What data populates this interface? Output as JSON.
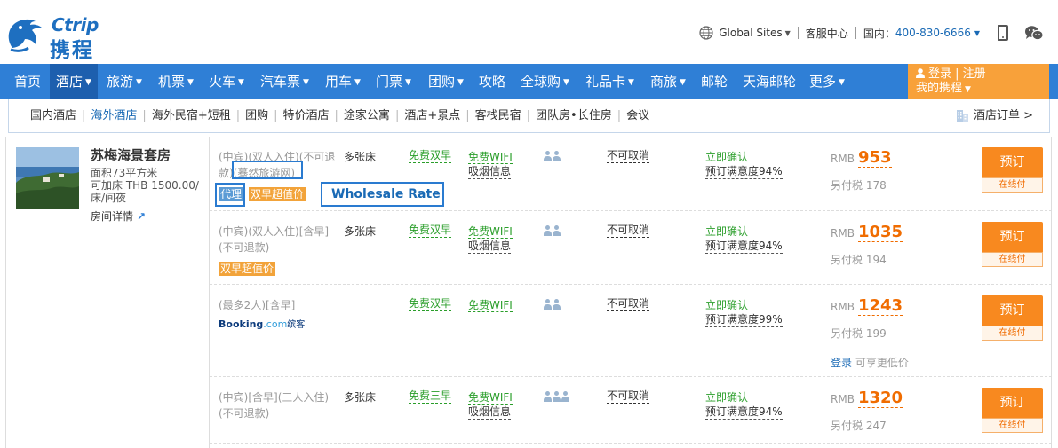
{
  "logo": {
    "en": "Ctrip",
    "cn": "携程"
  },
  "top_util": {
    "global_sites": "Global Sites",
    "service_center": "客服中心",
    "domestic_label": "国内：",
    "phone": "400-830-6666"
  },
  "nav": {
    "items": [
      {
        "label": "首页",
        "dropdown": false
      },
      {
        "label": "酒店",
        "dropdown": true,
        "active": true
      },
      {
        "label": "旅游",
        "dropdown": true
      },
      {
        "label": "机票",
        "dropdown": true
      },
      {
        "label": "火车",
        "dropdown": true
      },
      {
        "label": "汽车票",
        "dropdown": true
      },
      {
        "label": "用车",
        "dropdown": true
      },
      {
        "label": "门票",
        "dropdown": true
      },
      {
        "label": "团购",
        "dropdown": true
      },
      {
        "label": "攻略",
        "dropdown": false
      },
      {
        "label": "全球购",
        "dropdown": true
      },
      {
        "label": "礼品卡",
        "dropdown": true
      },
      {
        "label": "商旅",
        "dropdown": true
      },
      {
        "label": "邮轮",
        "dropdown": false
      },
      {
        "label": "天海邮轮",
        "dropdown": false
      },
      {
        "label": "更多",
        "dropdown": true
      }
    ],
    "account": {
      "login": "登录",
      "register": "注册",
      "my_ctrip": "我的携程"
    }
  },
  "subnav": {
    "items": [
      "国内酒店",
      "海外酒店",
      "海外民宿+短租",
      "团购",
      "特价酒店",
      "途家公寓",
      "酒店+景点",
      "客栈民宿",
      "团队房•长住房",
      "会议"
    ],
    "active_index": 1,
    "hotel_order": "酒店订单 >"
  },
  "room": {
    "name": "苏梅海景套房",
    "info_lines": [
      "面积73平方米",
      "可加床 THB 1500.00/",
      "床/间夜"
    ],
    "detail_link": "房间详情"
  },
  "rates": [
    {
      "name_lines": [
        "(中宾)(双人入住)(不可退",
        "款)(蓦然旅游网)"
      ],
      "bed": "多张床",
      "breakfast": "免费双早",
      "wifi": "免费WIFI",
      "smoke": "吸烟信息",
      "people": 2,
      "cancel": "不可取消",
      "confirm": "立即确认",
      "satisfaction": "预订满意度94%",
      "currency": "RMB",
      "price": "953",
      "tax": "另付税 178",
      "book": "预订",
      "pay": "在线付",
      "tag_agent": "代理",
      "tag_deal": "双早超值价",
      "annotation": "Wholesale Rate"
    },
    {
      "name_lines": [
        "(中宾)(双人入住)[含早]",
        "(不可退款)"
      ],
      "bed": "多张床",
      "breakfast": "免费双早",
      "wifi": "免费WIFI",
      "smoke": "吸烟信息",
      "people": 2,
      "cancel": "不可取消",
      "confirm": "立即确认",
      "satisfaction": "预订满意度94%",
      "currency": "RMB",
      "price": "1035",
      "tax": "另付税 194",
      "book": "预订",
      "pay": "在线付",
      "tag_deal": "双早超值价"
    },
    {
      "name_lines": [
        "(最多2人)[含早]"
      ],
      "bed": "",
      "breakfast": "免费双早",
      "wifi": "免费WIFI",
      "smoke": "",
      "people": 2,
      "cancel": "不可取消",
      "confirm": "立即确认",
      "satisfaction": "预订满意度99%",
      "currency": "RMB",
      "price": "1243",
      "tax": "另付税 199",
      "book": "预订",
      "pay": "在线付",
      "supplier": {
        "booking": "Booking",
        "com": ".com",
        "cn": "缤客"
      },
      "login_link": "登录",
      "login_hint": " 可享更低价"
    },
    {
      "name_lines": [
        "(中宾)[含早](三人入住)",
        "(不可退款)"
      ],
      "bed": "多张床",
      "breakfast": "免费三早",
      "wifi": "免费WIFI",
      "smoke": "吸烟信息",
      "people": 3,
      "cancel": "不可取消",
      "confirm": "立即确认",
      "satisfaction": "预订满意度94%",
      "currency": "RMB",
      "price": "1320",
      "tax": "另付税 247",
      "book": "预订",
      "pay": "在线付"
    }
  ],
  "colors": {
    "brand_blue": "#2f7fd6",
    "nav_active": "#1d5fae",
    "account_orange": "#f8a13a",
    "price_orange": "#f06c00",
    "book_button": "#f8891f",
    "green_text": "#2a9e2a",
    "annotation_blue": "#2a7bd0"
  },
  "icons": [
    "dolphin-logo-icon",
    "globe-icon",
    "chevron-down-icon",
    "mobile-icon",
    "wechat-icon",
    "user-icon",
    "building-icon",
    "person-icon",
    "arrow-up-right-icon"
  ]
}
